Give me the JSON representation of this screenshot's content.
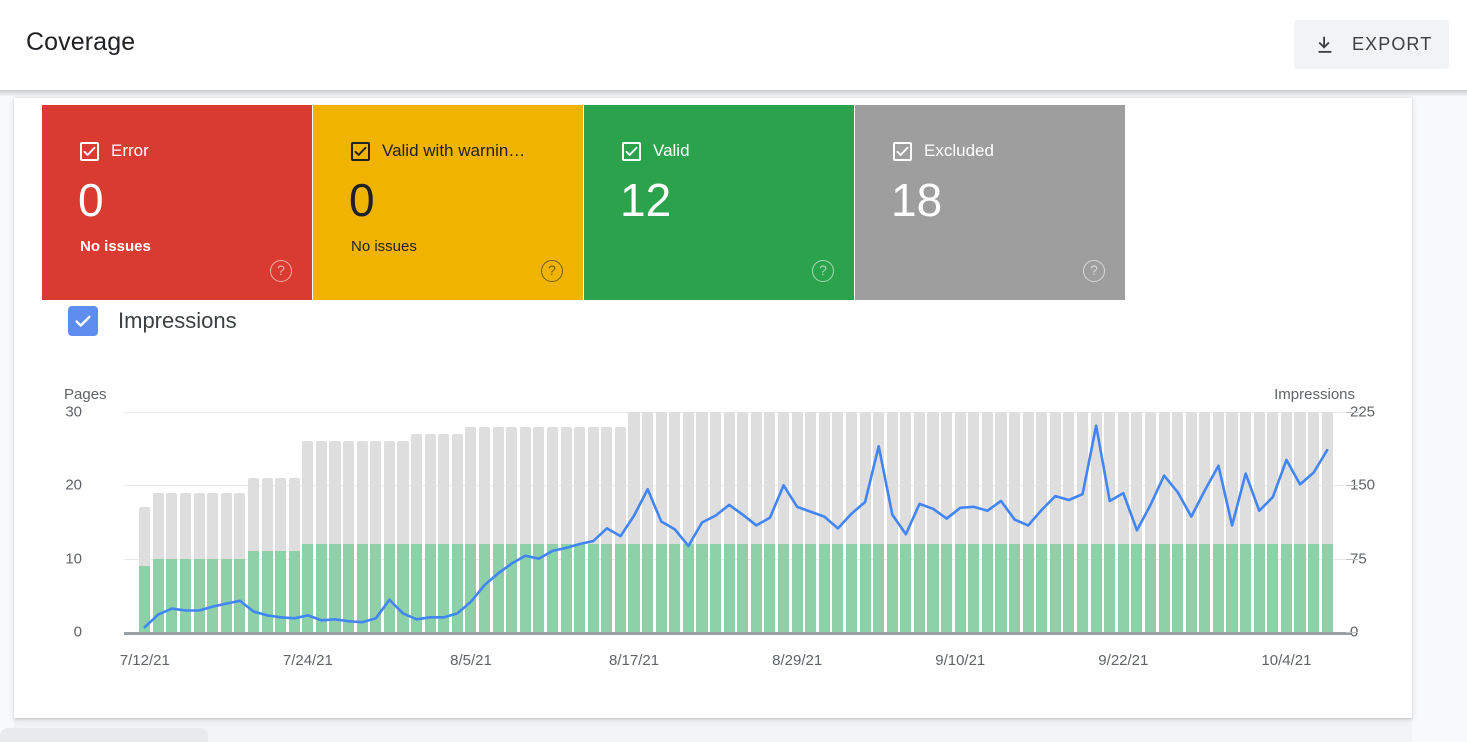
{
  "header": {
    "title": "Coverage",
    "export_label": "EXPORT",
    "download_icon": "download-icon"
  },
  "cards": [
    {
      "label": "Error",
      "value": "0",
      "sub": "No issues",
      "color": "#d93b30",
      "text": "#ffffff",
      "help_icon": "help-icon",
      "checked": true
    },
    {
      "label": "Valid with warnin…",
      "value": "0",
      "sub": "No issues",
      "color": "#f0b400",
      "text": "#202124",
      "help_icon": "help-icon",
      "checked": true
    },
    {
      "label": "Valid",
      "value": "12",
      "sub": "",
      "color": "#2ba24c",
      "text": "#ffffff",
      "help_icon": "help-icon",
      "checked": true
    },
    {
      "label": "Excluded",
      "value": "18",
      "sub": "",
      "color": "#9e9e9e",
      "text": "#ffffff",
      "help_icon": "help-icon",
      "checked": true
    }
  ],
  "impressions_toggle": {
    "label": "Impressions",
    "checked": true,
    "color": "#5c8def",
    "check_icon": "check-icon"
  },
  "chart_data": {
    "type": "bar",
    "title": "",
    "ylabel": "Pages",
    "y2label": "Impressions",
    "xlabel": "",
    "ylim": [
      0,
      30
    ],
    "y2lim": [
      0,
      225
    ],
    "yticks": [
      0,
      10,
      20,
      30
    ],
    "y2ticks": [
      0,
      75,
      150,
      225
    ],
    "grid": true,
    "legend": [
      "Valid",
      "Excluded",
      "Impressions"
    ],
    "colors": {
      "valid": "#8ed0a8",
      "excluded": "#dedede",
      "impressions": "#4285f4"
    },
    "xtick_labels": [
      "7/12/21",
      "7/24/21",
      "8/5/21",
      "8/17/21",
      "8/29/21",
      "9/10/21",
      "9/22/21",
      "10/4/21"
    ],
    "xtick_indices": [
      0,
      12,
      24,
      36,
      48,
      60,
      72,
      84
    ],
    "x": [
      "7/12/21",
      "7/13/21",
      "7/14/21",
      "7/15/21",
      "7/16/21",
      "7/17/21",
      "7/18/21",
      "7/19/21",
      "7/20/21",
      "7/21/21",
      "7/22/21",
      "7/23/21",
      "7/24/21",
      "7/25/21",
      "7/26/21",
      "7/27/21",
      "7/28/21",
      "7/29/21",
      "7/30/21",
      "7/31/21",
      "8/1/21",
      "8/2/21",
      "8/3/21",
      "8/4/21",
      "8/5/21",
      "8/6/21",
      "8/7/21",
      "8/8/21",
      "8/9/21",
      "8/10/21",
      "8/11/21",
      "8/12/21",
      "8/13/21",
      "8/14/21",
      "8/15/21",
      "8/16/21",
      "8/17/21",
      "8/18/21",
      "8/19/21",
      "8/20/21",
      "8/21/21",
      "8/22/21",
      "8/23/21",
      "8/24/21",
      "8/25/21",
      "8/26/21",
      "8/27/21",
      "8/28/21",
      "8/29/21",
      "8/30/21",
      "8/31/21",
      "9/1/21",
      "9/2/21",
      "9/3/21",
      "9/4/21",
      "9/5/21",
      "9/6/21",
      "9/7/21",
      "9/8/21",
      "9/9/21",
      "9/10/21",
      "9/11/21",
      "9/12/21",
      "9/13/21",
      "9/14/21",
      "9/15/21",
      "9/16/21",
      "9/17/21",
      "9/18/21",
      "9/19/21",
      "9/20/21",
      "9/21/21",
      "9/22/21",
      "9/23/21",
      "9/24/21",
      "9/25/21",
      "9/26/21",
      "9/27/21",
      "9/28/21",
      "9/29/21",
      "9/30/21",
      "10/1/21",
      "10/2/21",
      "10/3/21",
      "10/4/21",
      "10/5/21",
      "10/6/21",
      "10/7/21"
    ],
    "series": [
      {
        "name": "Valid",
        "axis": "left",
        "values": [
          9,
          10,
          10,
          10,
          10,
          10,
          10,
          10,
          11,
          11,
          11,
          11,
          12,
          12,
          12,
          12,
          12,
          12,
          12,
          12,
          12,
          12,
          12,
          12,
          12,
          12,
          12,
          12,
          12,
          12,
          12,
          12,
          12,
          12,
          12,
          12,
          12,
          12,
          12,
          12,
          12,
          12,
          12,
          12,
          12,
          12,
          12,
          12,
          12,
          12,
          12,
          12,
          12,
          12,
          12,
          12,
          12,
          12,
          12,
          12,
          12,
          12,
          12,
          12,
          12,
          12,
          12,
          12,
          12,
          12,
          12,
          12,
          12,
          12,
          12,
          12,
          12,
          12,
          12,
          12,
          12,
          12,
          12,
          12,
          12,
          12,
          12,
          12
        ]
      },
      {
        "name": "Excluded",
        "axis": "left",
        "values": [
          8,
          9,
          9,
          9,
          9,
          9,
          9,
          9,
          10,
          10,
          10,
          10,
          14,
          14,
          14,
          14,
          14,
          14,
          14,
          14,
          15,
          15,
          15,
          15,
          16,
          16,
          16,
          16,
          16,
          16,
          16,
          16,
          16,
          16,
          16,
          16,
          18,
          18,
          18,
          18,
          18,
          18,
          18,
          18,
          18,
          18,
          18,
          18,
          18,
          18,
          18,
          18,
          18,
          18,
          18,
          18,
          18,
          18,
          18,
          18,
          18,
          18,
          18,
          18,
          18,
          18,
          18,
          18,
          18,
          18,
          18,
          18,
          18,
          18,
          18,
          18,
          18,
          18,
          18,
          18,
          18,
          18,
          18,
          18,
          18,
          18,
          18,
          18
        ]
      },
      {
        "name": "Impressions",
        "axis": "right",
        "values": [
          5,
          18,
          24,
          22,
          22,
          26,
          29,
          32,
          21,
          17,
          15,
          14,
          17,
          12,
          13,
          11,
          10,
          14,
          33,
          19,
          13,
          15,
          15,
          19,
          31,
          48,
          60,
          70,
          78,
          75,
          83,
          86,
          90,
          93,
          106,
          98,
          119,
          146,
          113,
          105,
          88,
          112,
          119,
          130,
          120,
          109,
          117,
          150,
          128,
          123,
          118,
          106,
          121,
          133,
          190,
          120,
          100,
          131,
          126,
          116,
          127,
          128,
          124,
          134,
          115,
          109,
          125,
          139,
          135,
          141,
          211,
          134,
          142,
          104,
          130,
          160,
          143,
          118,
          145,
          170,
          109,
          162,
          124,
          138,
          176,
          151,
          163,
          186
        ]
      }
    ]
  }
}
